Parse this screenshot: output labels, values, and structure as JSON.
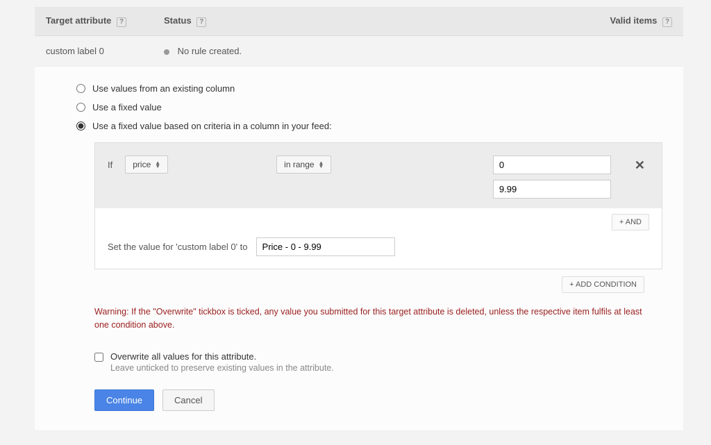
{
  "header": {
    "target_label": "Target attribute",
    "status_label": "Status",
    "valid_label": "Valid items"
  },
  "row": {
    "target": "custom label 0",
    "status": "No rule created."
  },
  "options": {
    "opt1": "Use values from an existing column",
    "opt2": "Use a fixed value",
    "opt3": "Use a fixed value based on criteria in a column in your feed:"
  },
  "condition": {
    "if_label": "If",
    "column": "price",
    "op": "in range",
    "from": "0",
    "to": "9.99",
    "and_label": "+ AND"
  },
  "setvalue": {
    "label": "Set the value for 'custom label 0' to",
    "value": "Price - 0 - 9.99"
  },
  "add_condition_label": "+ ADD CONDITION",
  "warning_text": "Warning: If the \"Overwrite\" tickbox is ticked, any value you submitted for this target attribute is deleted, unless the respective item fulfils at least one condition above.",
  "overwrite": {
    "title": "Overwrite all values for this attribute.",
    "sub": "Leave unticked to preserve existing values in the attribute."
  },
  "buttons": {
    "continue": "Continue",
    "cancel": "Cancel"
  }
}
